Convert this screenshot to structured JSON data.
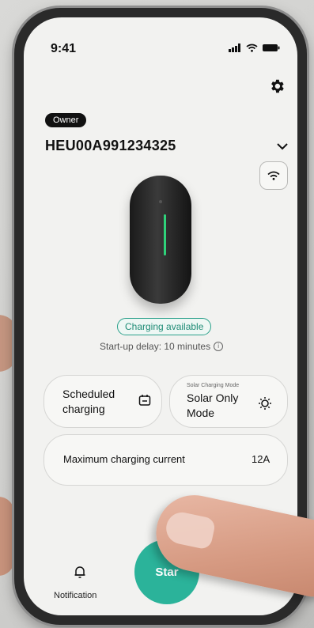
{
  "status_bar": {
    "time": "9:41"
  },
  "header": {
    "owner_badge": "Owner",
    "device_id": "HEU00A991234325"
  },
  "charger": {
    "status_badge": "Charging available",
    "startup_delay": "Start-up delay: 10 minutes",
    "led_color": "#2fd27a"
  },
  "cards": {
    "scheduled": {
      "line1": "Scheduled",
      "line2": "charging"
    },
    "solar": {
      "caption": "Solar Charging Mode",
      "line1": "Solar Only",
      "line2": "Mode"
    },
    "max_current": {
      "label": "Maximum charging current",
      "value": "12A"
    }
  },
  "bottom": {
    "notification_label": "Notification",
    "start_label": "Star"
  },
  "colors": {
    "accent": "#2bb39a",
    "badge_border": "#2aa08a",
    "background": "#f2f2f0"
  },
  "icons": [
    "gear-icon",
    "chevron-down-icon",
    "wifi-icon",
    "calendar-icon",
    "sun-icon",
    "bell-icon",
    "info-icon",
    "signal-icon",
    "battery-icon"
  ]
}
